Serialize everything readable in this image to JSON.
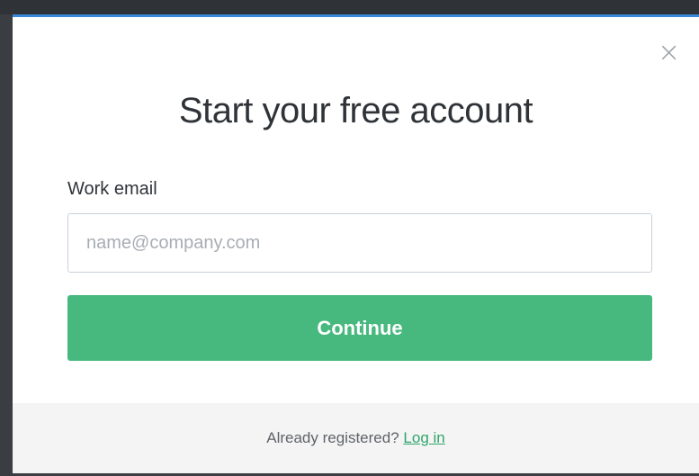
{
  "modal": {
    "title": "Start your free account",
    "close_symbol": "×",
    "email": {
      "label": "Work email",
      "placeholder": "name@company.com",
      "value": ""
    },
    "continue_label": "Continue",
    "footer": {
      "prompt": "Already registered?",
      "login_label": "Log in"
    }
  },
  "colors": {
    "accent_top_border": "#3a88d8",
    "button_green": "#47b97e",
    "link_green": "#2fa56b",
    "footer_bg": "#f4f4f4"
  },
  "icons": {
    "close": "close-icon"
  }
}
